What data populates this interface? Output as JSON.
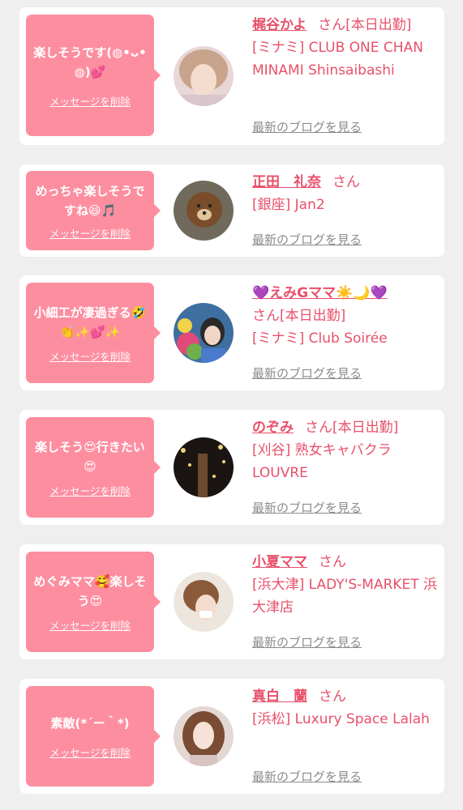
{
  "colors": {
    "accent": "#e8506a",
    "bubble": "#fd8ea0",
    "link_gray": "#8b8b8b",
    "background": "#efefef"
  },
  "delete_label": "メッセージを削除",
  "blog_label": "最新のブログを見る",
  "san_label": "さん",
  "entries": [
    {
      "message": "楽しそうです(◍•ᴗ•◍)💕",
      "name": "梶谷かよ",
      "status": "[本日出勤]",
      "venue": "[ミナミ] CLUB ONE CHAN MINAMI Shinsaibashi"
    },
    {
      "message": "めっちゃ楽しそうですね😆🎵",
      "name": "正田　礼奈",
      "status": "",
      "venue": "[銀座] Jan2"
    },
    {
      "message": "小細工が凄過ぎる🤣👏✨💕✨",
      "name": "💜えみGママ☀️🌙💜",
      "status": "[本日出勤]",
      "venue": "[ミナミ] Club Soirée"
    },
    {
      "message": "楽しそう😍行きたい😍",
      "name": "のぞみ",
      "status": "[本日出勤]",
      "venue": "[刈谷] 熟女キャバクラ LOUVRE"
    },
    {
      "message": "めぐみママ🥰楽しそう😍",
      "name": "小夏ママ",
      "status": "",
      "venue": "[浜大津] LADY'S-MARKET 浜大津店"
    },
    {
      "message": "素敵(*´ー｀*)",
      "name": "真白　蘭",
      "status": "",
      "venue": "[浜松] Luxury Space Lalah"
    }
  ]
}
